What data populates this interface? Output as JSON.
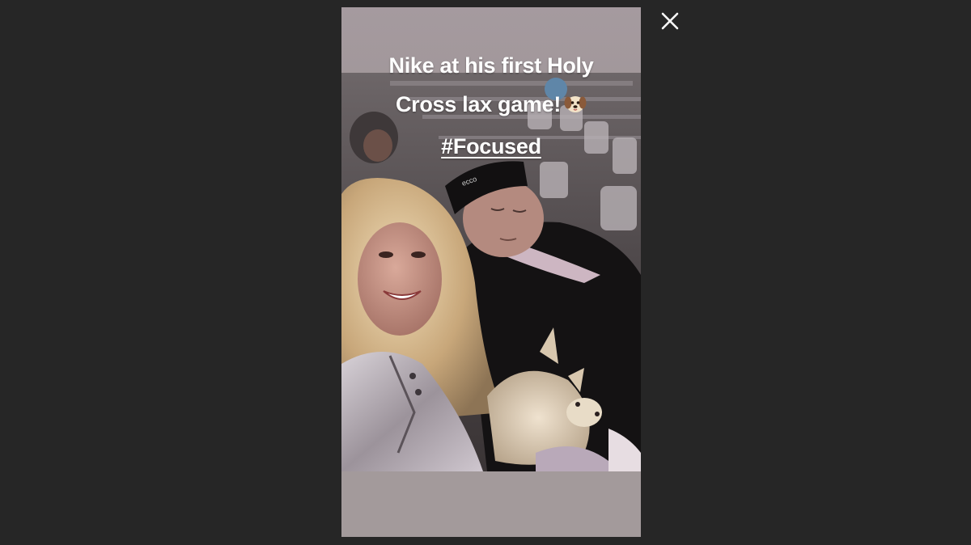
{
  "viewer": {
    "background_color": "#262626",
    "close_icon": "close-icon"
  },
  "story": {
    "caption": {
      "line1": "Nike at his first Holy",
      "line2": "Cross lax game!",
      "line2_emoji": "dog-face-icon",
      "line3": "#Focused"
    },
    "photo": {
      "subject": "selfie-photo"
    },
    "band_color": "#a49b9d"
  }
}
